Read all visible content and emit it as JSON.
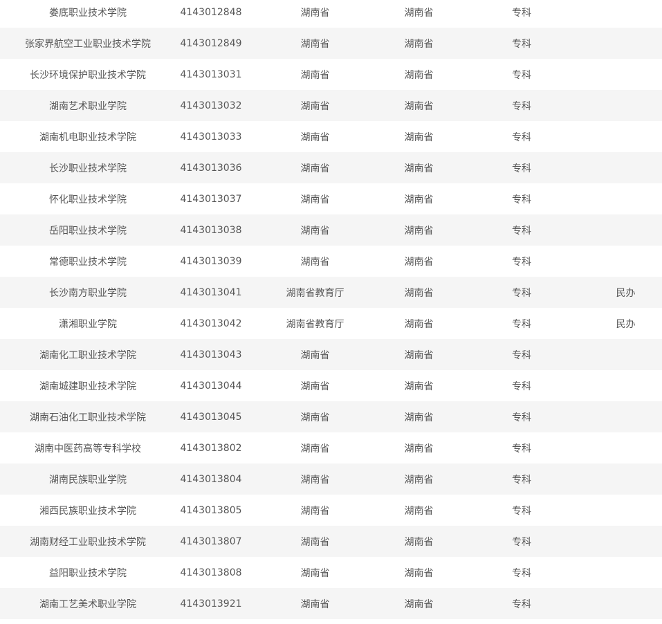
{
  "table": {
    "rows": [
      [
        "娄底职业技术学院",
        "4143012848",
        "湖南省",
        "湖南省",
        "专科",
        ""
      ],
      [
        "张家界航空工业职业技术学院",
        "4143012849",
        "湖南省",
        "湖南省",
        "专科",
        ""
      ],
      [
        "长沙环境保护职业技术学院",
        "4143013031",
        "湖南省",
        "湖南省",
        "专科",
        ""
      ],
      [
        "湖南艺术职业学院",
        "4143013032",
        "湖南省",
        "湖南省",
        "专科",
        ""
      ],
      [
        "湖南机电职业技术学院",
        "4143013033",
        "湖南省",
        "湖南省",
        "专科",
        ""
      ],
      [
        "长沙职业技术学院",
        "4143013036",
        "湖南省",
        "湖南省",
        "专科",
        ""
      ],
      [
        "怀化职业技术学院",
        "4143013037",
        "湖南省",
        "湖南省",
        "专科",
        ""
      ],
      [
        "岳阳职业技术学院",
        "4143013038",
        "湖南省",
        "湖南省",
        "专科",
        ""
      ],
      [
        "常德职业技术学院",
        "4143013039",
        "湖南省",
        "湖南省",
        "专科",
        ""
      ],
      [
        "长沙南方职业学院",
        "4143013041",
        "湖南省教育厅",
        "湖南省",
        "专科",
        "民办"
      ],
      [
        "潇湘职业学院",
        "4143013042",
        "湖南省教育厅",
        "湖南省",
        "专科",
        "民办"
      ],
      [
        "湖南化工职业技术学院",
        "4143013043",
        "湖南省",
        "湖南省",
        "专科",
        ""
      ],
      [
        "湖南城建职业技术学院",
        "4143013044",
        "湖南省",
        "湖南省",
        "专科",
        ""
      ],
      [
        "湖南石油化工职业技术学院",
        "4143013045",
        "湖南省",
        "湖南省",
        "专科",
        ""
      ],
      [
        "湖南中医药高等专科学校",
        "4143013802",
        "湖南省",
        "湖南省",
        "专科",
        ""
      ],
      [
        "湖南民族职业学院",
        "4143013804",
        "湖南省",
        "湖南省",
        "专科",
        ""
      ],
      [
        "湘西民族职业技术学院",
        "4143013805",
        "湖南省",
        "湖南省",
        "专科",
        ""
      ],
      [
        "湖南财经工业职业技术学院",
        "4143013807",
        "湖南省",
        "湖南省",
        "专科",
        ""
      ],
      [
        "益阳职业技术学院",
        "4143013808",
        "湖南省",
        "湖南省",
        "专科",
        ""
      ],
      [
        "湖南工艺美术职业学院",
        "4143013921",
        "湖南省",
        "湖南省",
        "专科",
        ""
      ]
    ]
  }
}
